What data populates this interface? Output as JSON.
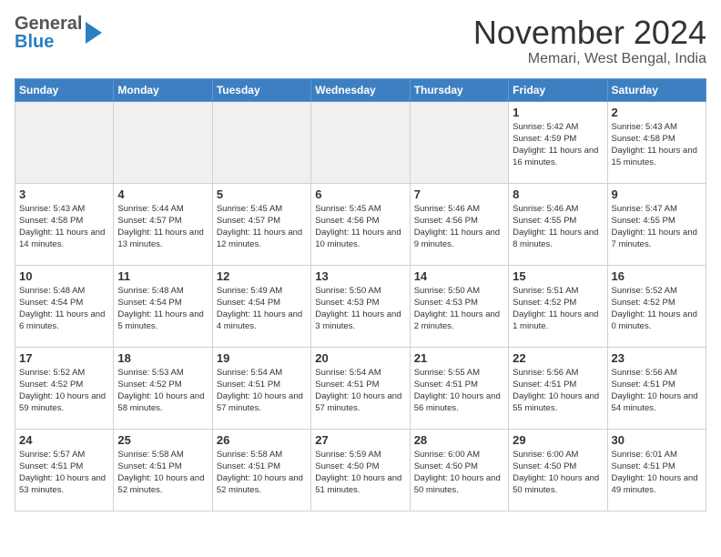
{
  "logo": {
    "line1": "General",
    "line2": "Blue"
  },
  "title": "November 2024",
  "location": "Memari, West Bengal, India",
  "weekdays": [
    "Sunday",
    "Monday",
    "Tuesday",
    "Wednesday",
    "Thursday",
    "Friday",
    "Saturday"
  ],
  "weeks": [
    [
      {
        "day": "",
        "info": ""
      },
      {
        "day": "",
        "info": ""
      },
      {
        "day": "",
        "info": ""
      },
      {
        "day": "",
        "info": ""
      },
      {
        "day": "",
        "info": ""
      },
      {
        "day": "1",
        "info": "Sunrise: 5:42 AM\nSunset: 4:59 PM\nDaylight: 11 hours\nand 16 minutes."
      },
      {
        "day": "2",
        "info": "Sunrise: 5:43 AM\nSunset: 4:58 PM\nDaylight: 11 hours\nand 15 minutes."
      }
    ],
    [
      {
        "day": "3",
        "info": "Sunrise: 5:43 AM\nSunset: 4:58 PM\nDaylight: 11 hours\nand 14 minutes."
      },
      {
        "day": "4",
        "info": "Sunrise: 5:44 AM\nSunset: 4:57 PM\nDaylight: 11 hours\nand 13 minutes."
      },
      {
        "day": "5",
        "info": "Sunrise: 5:45 AM\nSunset: 4:57 PM\nDaylight: 11 hours\nand 12 minutes."
      },
      {
        "day": "6",
        "info": "Sunrise: 5:45 AM\nSunset: 4:56 PM\nDaylight: 11 hours\nand 10 minutes."
      },
      {
        "day": "7",
        "info": "Sunrise: 5:46 AM\nSunset: 4:56 PM\nDaylight: 11 hours\nand 9 minutes."
      },
      {
        "day": "8",
        "info": "Sunrise: 5:46 AM\nSunset: 4:55 PM\nDaylight: 11 hours\nand 8 minutes."
      },
      {
        "day": "9",
        "info": "Sunrise: 5:47 AM\nSunset: 4:55 PM\nDaylight: 11 hours\nand 7 minutes."
      }
    ],
    [
      {
        "day": "10",
        "info": "Sunrise: 5:48 AM\nSunset: 4:54 PM\nDaylight: 11 hours\nand 6 minutes."
      },
      {
        "day": "11",
        "info": "Sunrise: 5:48 AM\nSunset: 4:54 PM\nDaylight: 11 hours\nand 5 minutes."
      },
      {
        "day": "12",
        "info": "Sunrise: 5:49 AM\nSunset: 4:54 PM\nDaylight: 11 hours\nand 4 minutes."
      },
      {
        "day": "13",
        "info": "Sunrise: 5:50 AM\nSunset: 4:53 PM\nDaylight: 11 hours\nand 3 minutes."
      },
      {
        "day": "14",
        "info": "Sunrise: 5:50 AM\nSunset: 4:53 PM\nDaylight: 11 hours\nand 2 minutes."
      },
      {
        "day": "15",
        "info": "Sunrise: 5:51 AM\nSunset: 4:52 PM\nDaylight: 11 hours\nand 1 minute."
      },
      {
        "day": "16",
        "info": "Sunrise: 5:52 AM\nSunset: 4:52 PM\nDaylight: 11 hours\nand 0 minutes."
      }
    ],
    [
      {
        "day": "17",
        "info": "Sunrise: 5:52 AM\nSunset: 4:52 PM\nDaylight: 10 hours\nand 59 minutes."
      },
      {
        "day": "18",
        "info": "Sunrise: 5:53 AM\nSunset: 4:52 PM\nDaylight: 10 hours\nand 58 minutes."
      },
      {
        "day": "19",
        "info": "Sunrise: 5:54 AM\nSunset: 4:51 PM\nDaylight: 10 hours\nand 57 minutes."
      },
      {
        "day": "20",
        "info": "Sunrise: 5:54 AM\nSunset: 4:51 PM\nDaylight: 10 hours\nand 57 minutes."
      },
      {
        "day": "21",
        "info": "Sunrise: 5:55 AM\nSunset: 4:51 PM\nDaylight: 10 hours\nand 56 minutes."
      },
      {
        "day": "22",
        "info": "Sunrise: 5:56 AM\nSunset: 4:51 PM\nDaylight: 10 hours\nand 55 minutes."
      },
      {
        "day": "23",
        "info": "Sunrise: 5:56 AM\nSunset: 4:51 PM\nDaylight: 10 hours\nand 54 minutes."
      }
    ],
    [
      {
        "day": "24",
        "info": "Sunrise: 5:57 AM\nSunset: 4:51 PM\nDaylight: 10 hours\nand 53 minutes."
      },
      {
        "day": "25",
        "info": "Sunrise: 5:58 AM\nSunset: 4:51 PM\nDaylight: 10 hours\nand 52 minutes."
      },
      {
        "day": "26",
        "info": "Sunrise: 5:58 AM\nSunset: 4:51 PM\nDaylight: 10 hours\nand 52 minutes."
      },
      {
        "day": "27",
        "info": "Sunrise: 5:59 AM\nSunset: 4:50 PM\nDaylight: 10 hours\nand 51 minutes."
      },
      {
        "day": "28",
        "info": "Sunrise: 6:00 AM\nSunset: 4:50 PM\nDaylight: 10 hours\nand 50 minutes."
      },
      {
        "day": "29",
        "info": "Sunrise: 6:00 AM\nSunset: 4:50 PM\nDaylight: 10 hours\nand 50 minutes."
      },
      {
        "day": "30",
        "info": "Sunrise: 6:01 AM\nSunset: 4:51 PM\nDaylight: 10 hours\nand 49 minutes."
      }
    ]
  ]
}
